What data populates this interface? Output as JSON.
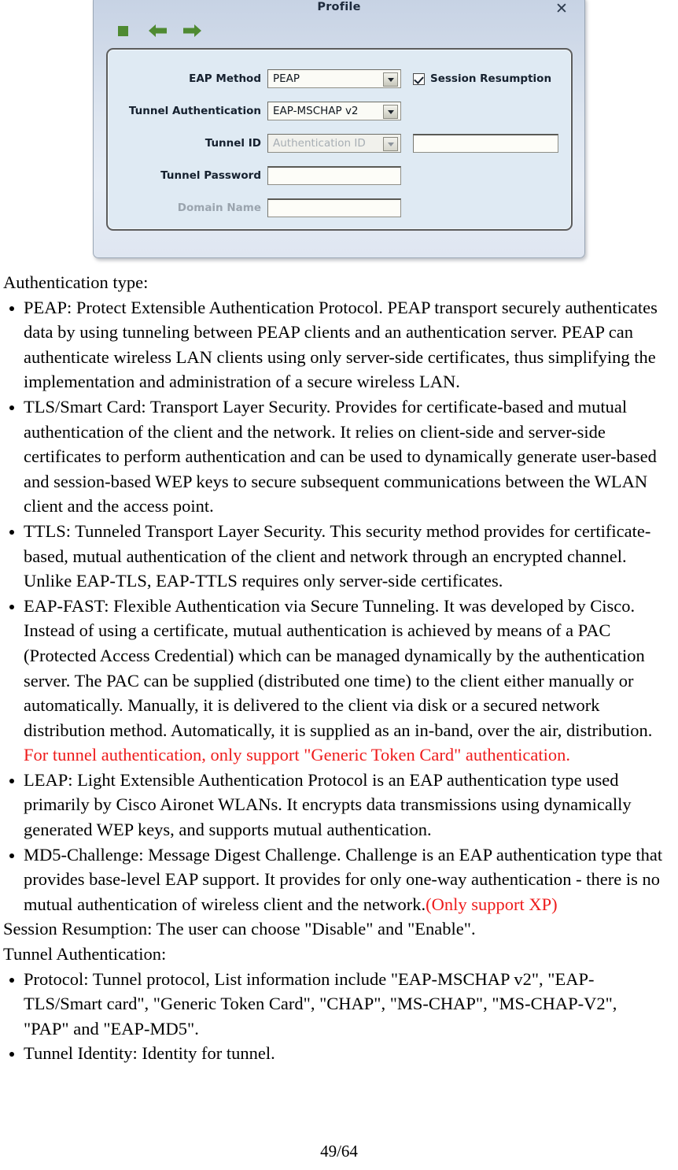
{
  "dialog": {
    "title": "Profile",
    "close_label": "✕",
    "toolbar": [
      {
        "name": "stop-icon",
        "label": "Stop"
      },
      {
        "name": "back-arrow-icon",
        "label": "Back"
      },
      {
        "name": "forward-arrow-icon",
        "label": "Forward"
      }
    ],
    "fields": {
      "eap_method": {
        "label": "EAP Method",
        "value": "PEAP",
        "enabled": true
      },
      "tunnel_authentication": {
        "label": "Tunnel Authentication",
        "value": "EAP-MSCHAP v2",
        "enabled": true
      },
      "tunnel_id": {
        "label": "Tunnel ID",
        "value": "Authentication ID",
        "enabled": false,
        "text_value": ""
      },
      "tunnel_password": {
        "label": "Tunnel Password",
        "value": ""
      },
      "domain_name": {
        "label": "Domain Name",
        "value": ""
      }
    },
    "session_resumption": {
      "label": "Session Resumption",
      "checked": true
    },
    "colors": {
      "titlebar": "#c6d2e4",
      "panel": "#dfeaf3",
      "icon_green": "#4f8a32"
    }
  },
  "document": {
    "heading_auth_type": "Authentication type:",
    "auth_types": [
      "PEAP: Protect Extensible Authentication Protocol. PEAP transport securely authenticates data by using tunneling between PEAP clients and an authentication server. PEAP can authenticate wireless LAN clients using only server-side certificates, thus simplifying the implementation and administration of a secure wireless LAN.",
      "TLS/Smart Card: Transport Layer Security. Provides for certificate-based and mutual authentication of the client and the network. It relies on client-side and server-side certificates to perform authentication and can be used to dynamically generate user-based and session-based WEP keys to secure subsequent communications between the WLAN client and the access point.",
      "TTLS: Tunneled Transport Layer Security. This security method provides for certificate-based, mutual authentication of the client and network through an encrypted channel. Unlike EAP-TLS, EAP-TTLS requires only server-side certificates."
    ],
    "eap_fast": {
      "black_text": "EAP-FAST: Flexible Authentication via Secure Tunneling. It was developed by Cisco. Instead of using a certificate, mutual authentication is achieved by means of a PAC (Protected Access Credential) which can be managed dynamically by the authentication server. The PAC can be supplied (distributed one time) to the client either manually or automatically. Manually, it is delivered to the client via disk or a secured network distribution method. Automatically, it is supplied as an in-band, over the air, distribution. ",
      "red_text": "For tunnel authentication, only support \"Generic Token Card\" authentication."
    },
    "leap": "LEAP: Light Extensible Authentication Protocol is an EAP authentication type used primarily by Cisco Aironet WLANs. It encrypts data transmissions using dynamically generated WEP keys, and supports mutual authentication.",
    "md5": {
      "black_text": "MD5-Challenge: Message Digest Challenge. Challenge is an EAP authentication type that provides base-level EAP support. It provides for only one-way authentication - there is no mutual authentication of wireless client and the network.",
      "red_text": "(Only support XP)"
    },
    "session_resumption_note": "Session Resumption: The user can choose \"Disable\" and \"Enable\".",
    "heading_tunnel_auth": "Tunnel Authentication:",
    "tunnel_items": [
      "Protocol: Tunnel protocol, List information include \"EAP-MSCHAP v2\", \"EAP-TLS/Smart card\", \"Generic Token Card\", \"CHAP\", \"MS-CHAP\", \"MS-CHAP-V2\", \"PAP\" and \"EAP-MD5\".",
      "Tunnel Identity: Identity for tunnel."
    ],
    "page_number": "49/64"
  }
}
